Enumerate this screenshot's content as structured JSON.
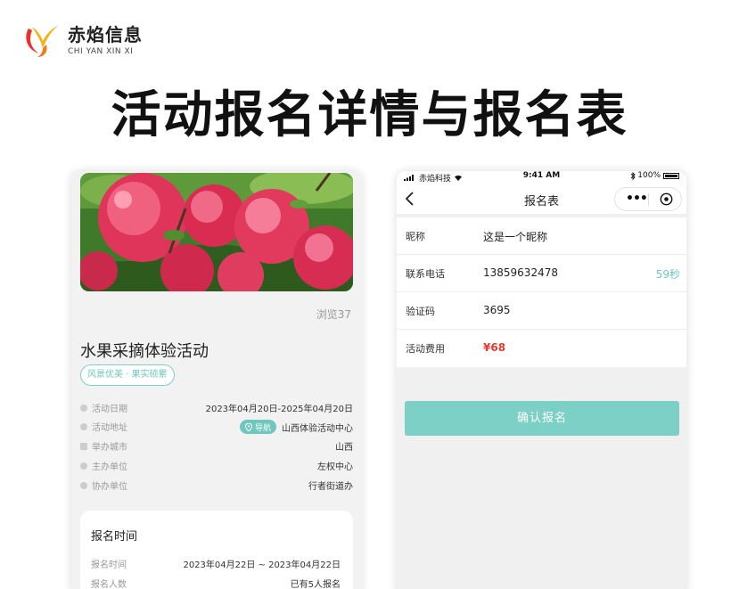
{
  "brand": {
    "name": "赤焰信息",
    "subtitle": "CHI YAN XIN XI"
  },
  "headline": "活动报名详情与报名表",
  "detail": {
    "views": "浏览37",
    "title": "水果采摘体验活动",
    "tag": "风景优美 · 果实硕累",
    "info": [
      {
        "label": "活动日期",
        "value": "2023年04月20日-2025年04月20日"
      },
      {
        "label": "活动地址",
        "nav": "导航",
        "value": "山西体验活动中心"
      },
      {
        "label": "举办城市",
        "value": "山西"
      },
      {
        "label": "主办单位",
        "value": "左权中心"
      },
      {
        "label": "协办单位",
        "value": "行者街道办"
      }
    ],
    "signup": {
      "title": "报名时间",
      "rows": [
        {
          "label": "报名时间",
          "value": "2023年04月22日 ~ 2023年04月22日"
        },
        {
          "label": "报名人数",
          "value": "已有5人报名"
        }
      ]
    }
  },
  "form": {
    "status": {
      "carrier": "赤焰科技",
      "time": "9:41 AM",
      "battery": "100%"
    },
    "nav_title": "报名表",
    "capsule_more": "•••",
    "rows": [
      {
        "label": "昵称",
        "value": "这是一个昵称"
      },
      {
        "label": "联系电话",
        "value": "13859632478",
        "countdown": "59秒"
      },
      {
        "label": "验证码",
        "value": "3695"
      },
      {
        "label": "活动费用",
        "value": "¥68"
      }
    ],
    "confirm": "确认报名"
  },
  "colors": {
    "accent": "#7dd0c5",
    "price": "#e23b2d"
  },
  "icons": [
    "brand-logo-icon",
    "back-arrow-icon",
    "more-icon",
    "close-circle-icon",
    "location-pin-icon",
    "signal-icon",
    "wifi-icon",
    "battery-icon"
  ]
}
